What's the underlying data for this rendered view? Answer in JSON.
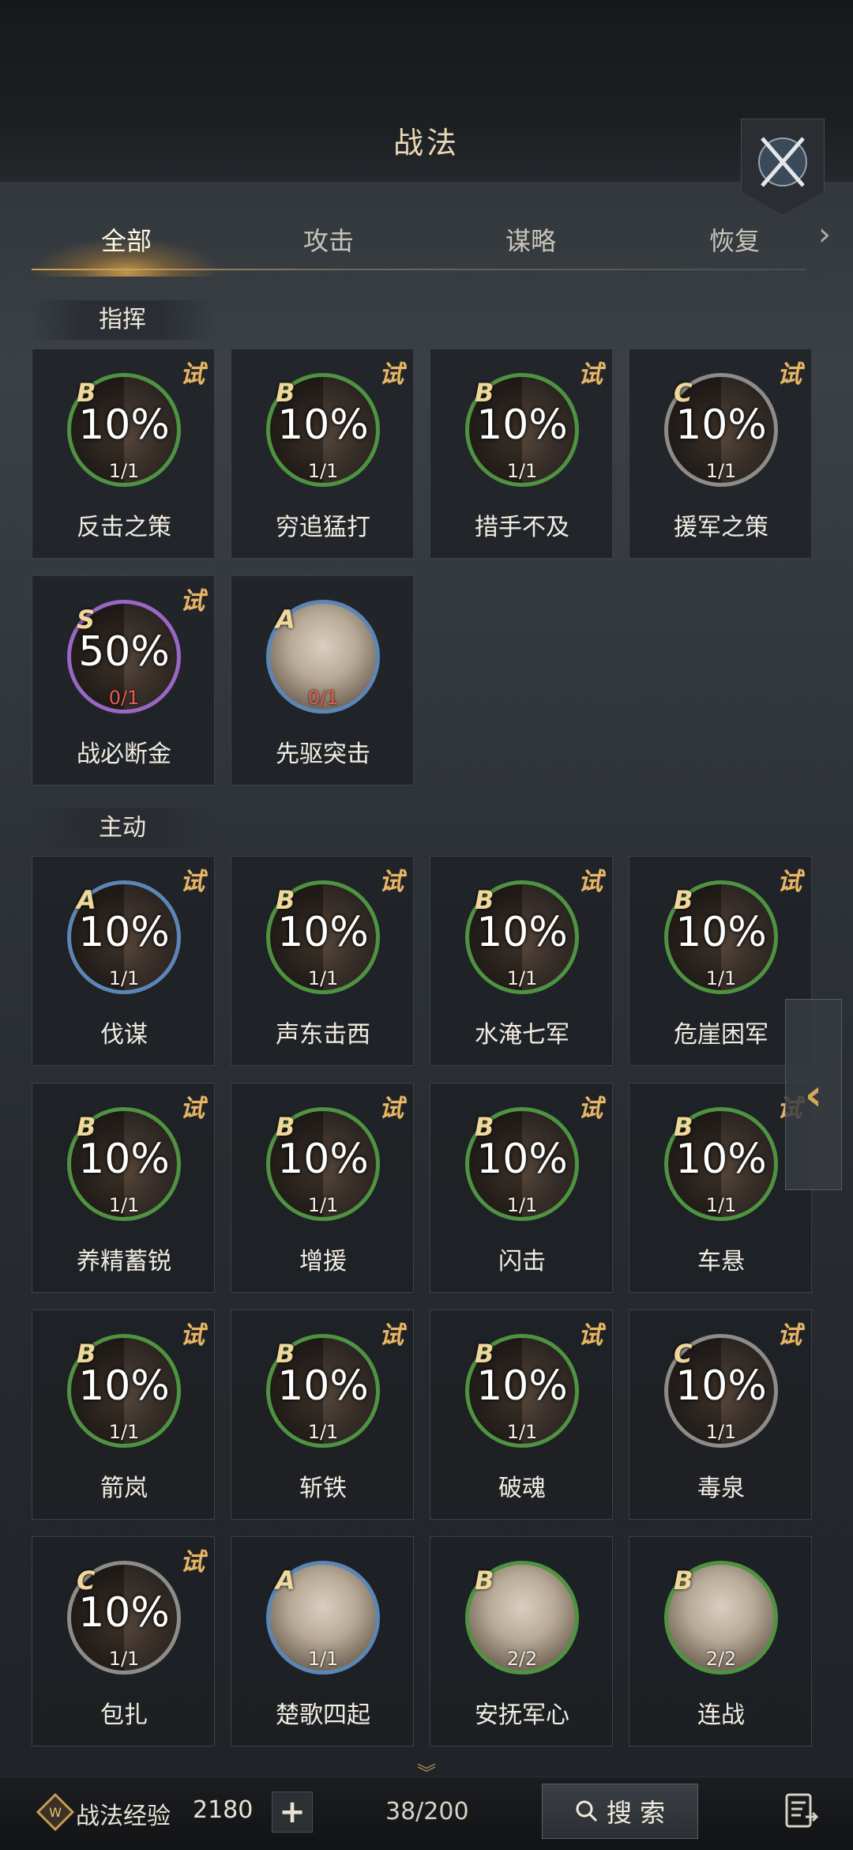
{
  "header": {
    "title": "战法"
  },
  "tabs": [
    {
      "label": "全部",
      "active": true
    },
    {
      "label": "攻击",
      "active": false
    },
    {
      "label": "谋略",
      "active": false
    },
    {
      "label": "恢复",
      "active": false
    }
  ],
  "sections": {
    "command": {
      "label": "指挥",
      "cards": [
        {
          "name": "反击之策",
          "grade": "B",
          "pct": "10%",
          "count": "1/1",
          "trial": "试",
          "ring": "green"
        },
        {
          "name": "穷追猛打",
          "grade": "B",
          "pct": "10%",
          "count": "1/1",
          "trial": "试",
          "ring": "green"
        },
        {
          "name": "措手不及",
          "grade": "B",
          "pct": "10%",
          "count": "1/1",
          "trial": "试",
          "ring": "green"
        },
        {
          "name": "援军之策",
          "grade": "C",
          "pct": "10%",
          "count": "1/1",
          "trial": "试",
          "ring": "gray"
        },
        {
          "name": "战必断金",
          "grade": "S",
          "pct": "50%",
          "count": "0/1",
          "trial": "试",
          "ring": "purple"
        },
        {
          "name": "先驱突击",
          "grade": "A",
          "pct": "",
          "count": "0/1",
          "trial": "",
          "ring": "blue"
        }
      ]
    },
    "active": {
      "label": "主动",
      "cards": [
        {
          "name": "伐谋",
          "grade": "A",
          "pct": "10%",
          "count": "1/1",
          "trial": "试",
          "ring": "blue"
        },
        {
          "name": "声东击西",
          "grade": "B",
          "pct": "10%",
          "count": "1/1",
          "trial": "试",
          "ring": "green"
        },
        {
          "name": "水淹七军",
          "grade": "B",
          "pct": "10%",
          "count": "1/1",
          "trial": "试",
          "ring": "green"
        },
        {
          "name": "危崖困军",
          "grade": "B",
          "pct": "10%",
          "count": "1/1",
          "trial": "试",
          "ring": "green"
        },
        {
          "name": "养精蓄锐",
          "grade": "B",
          "pct": "10%",
          "count": "1/1",
          "trial": "试",
          "ring": "green"
        },
        {
          "name": "增援",
          "grade": "B",
          "pct": "10%",
          "count": "1/1",
          "trial": "试",
          "ring": "green"
        },
        {
          "name": "闪击",
          "grade": "B",
          "pct": "10%",
          "count": "1/1",
          "trial": "试",
          "ring": "green"
        },
        {
          "name": "车悬",
          "grade": "B",
          "pct": "10%",
          "count": "1/1",
          "trial": "试",
          "ring": "green"
        },
        {
          "name": "箭岚",
          "grade": "B",
          "pct": "10%",
          "count": "1/1",
          "trial": "试",
          "ring": "green"
        },
        {
          "name": "斩铁",
          "grade": "B",
          "pct": "10%",
          "count": "1/1",
          "trial": "试",
          "ring": "green"
        },
        {
          "name": "破魂",
          "grade": "B",
          "pct": "10%",
          "count": "1/1",
          "trial": "试",
          "ring": "green"
        },
        {
          "name": "毒泉",
          "grade": "C",
          "pct": "10%",
          "count": "1/1",
          "trial": "试",
          "ring": "gray"
        },
        {
          "name": "包扎",
          "grade": "C",
          "pct": "10%",
          "count": "1/1",
          "trial": "试",
          "ring": "gray"
        },
        {
          "name": "楚歌四起",
          "grade": "A",
          "pct": "",
          "count": "1/1",
          "trial": "",
          "ring": "blue"
        },
        {
          "name": "安抚军心",
          "grade": "B",
          "pct": "",
          "count": "2/2",
          "trial": "",
          "ring": "green"
        },
        {
          "name": "连战",
          "grade": "B",
          "pct": "",
          "count": "2/2",
          "trial": "",
          "ring": "green"
        }
      ]
    }
  },
  "bottom": {
    "exp_label": "战法经验",
    "exp_value": "2180",
    "plus": "+",
    "capacity": "38/200",
    "search_label": "搜 索"
  },
  "colors": {
    "accent_gold": "#e8b566",
    "ring_green": "#4f9342",
    "ring_blue": "#5b86b6",
    "ring_gray": "#8d8c88",
    "ring_purple": "#9a67c4"
  }
}
